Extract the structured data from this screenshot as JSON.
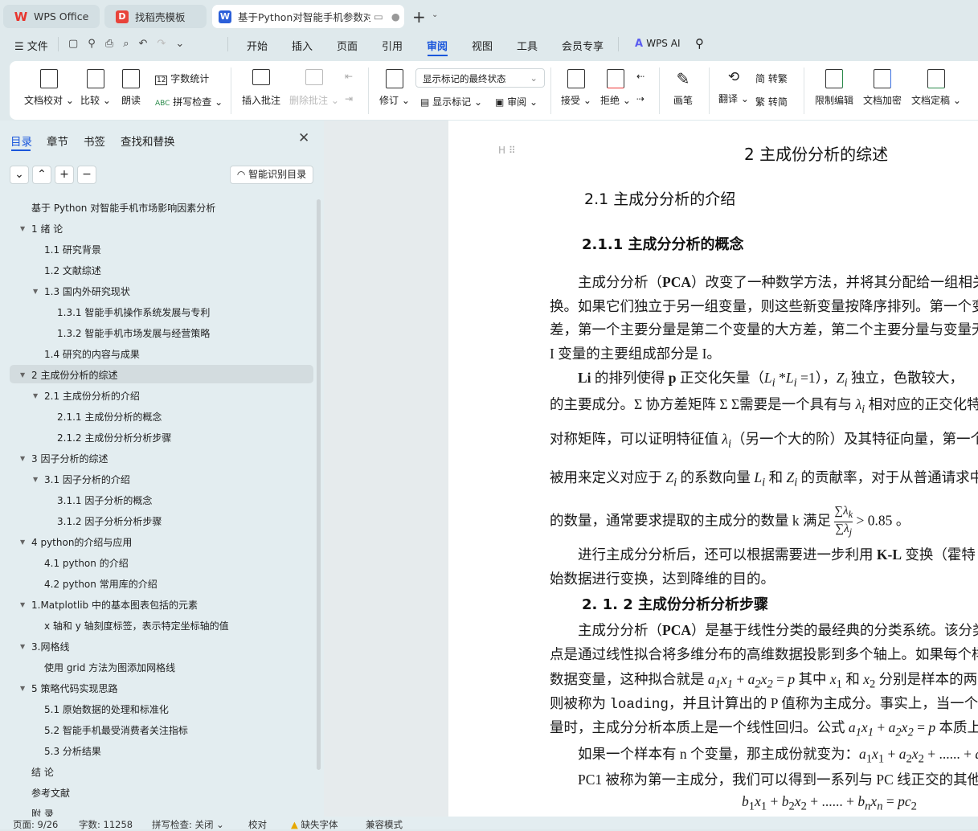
{
  "tabs": [
    {
      "label": "WPS Office",
      "icon": "wps-logo"
    },
    {
      "label": "找稻壳模板",
      "icon": "docer-logo"
    },
    {
      "label": "基于Python对智能手机参数对",
      "icon": "word-doc-icon"
    }
  ],
  "menu": {
    "file": "文件",
    "items": [
      "开始",
      "插入",
      "页面",
      "引用",
      "审阅",
      "视图",
      "工具",
      "会员专享"
    ],
    "active": "审阅",
    "wps_ai": "WPS AI"
  },
  "ribbon": {
    "proofread": "文档校对",
    "compare": "比较",
    "read_aloud": "朗读",
    "word_count": "字数统计",
    "spell_check": "拼写检查",
    "insert_comment": "插入批注",
    "delete_comment": "删除批注",
    "track": "修订",
    "markup_dropdown": "显示标记的最终状态",
    "show_markup": "显示标记",
    "review": "审阅",
    "accept": "接受",
    "reject": "拒绝",
    "pen": "画笔",
    "translate": "翻译",
    "to_traditional": "转繁",
    "to_simplified": "转简",
    "restrict": "限制编辑",
    "encrypt": "文档加密",
    "finalize": "文档定稿"
  },
  "sidebar": {
    "tabs": [
      "目录",
      "章节",
      "书签",
      "查找和替换"
    ],
    "active_tab": "目录",
    "smart_toc": "智能识别目录",
    "items": [
      {
        "label": "基于 Python 对智能手机市场影响因素分析",
        "level": 0,
        "toggle": false
      },
      {
        "label": "1  绪  论",
        "level": 0,
        "toggle": true
      },
      {
        "label": "1.1 研究背景",
        "level": 1,
        "toggle": false
      },
      {
        "label": "1.2 文献综述",
        "level": 1,
        "toggle": false
      },
      {
        "label": "1.3 国内外研究现状",
        "level": 1,
        "toggle": true
      },
      {
        "label": "1.3.1 智能手机操作系统发展与专利",
        "level": 2,
        "toggle": false
      },
      {
        "label": "1.3.2 智能手机市场发展与经营策略",
        "level": 2,
        "toggle": false
      },
      {
        "label": "1.4  研究的内容与成果",
        "level": 1,
        "toggle": false
      },
      {
        "label": "2 主成份分析的综述",
        "level": 0,
        "toggle": true,
        "selected": true
      },
      {
        "label": "2.1 主成份分析的介绍",
        "level": 1,
        "toggle": true
      },
      {
        "label": "2.1.1 主成份分析的概念",
        "level": 2,
        "toggle": false
      },
      {
        "label": "2.1.2 主成份分析分析步骤",
        "level": 2,
        "toggle": false
      },
      {
        "label": "3  因子分析的综述",
        "level": 0,
        "toggle": true
      },
      {
        "label": "3.1  因子分析的介绍",
        "level": 1,
        "toggle": true
      },
      {
        "label": "3.1.1  因子分析的概念",
        "level": 2,
        "toggle": false
      },
      {
        "label": "3.1.2 因子分析分析步骤",
        "level": 2,
        "toggle": false
      },
      {
        "label": "4 python的介绍与应用",
        "level": 0,
        "toggle": true
      },
      {
        "label": "4.1 python 的介绍",
        "level": 1,
        "toggle": false
      },
      {
        "label": "4.2 python 常用库的介绍",
        "level": 1,
        "toggle": false
      },
      {
        "label": "1.Matplotlib 中的基本图表包括的元素",
        "level": 0,
        "toggle": true
      },
      {
        "label": "x 轴和 y 轴刻度标签，表示特定坐标轴的值",
        "level": 1,
        "toggle": false
      },
      {
        "label": "3.网格线",
        "level": 0,
        "toggle": true
      },
      {
        "label": "使用 grid 方法为图添加网格线",
        "level": 1,
        "toggle": false
      },
      {
        "label": "5 策略代码实现思路",
        "level": 0,
        "toggle": true
      },
      {
        "label": "5.1  原始数据的处理和标准化",
        "level": 1,
        "toggle": false
      },
      {
        "label": "5.2  智能手机最受消费者关注指标",
        "level": 1,
        "toggle": false
      },
      {
        "label": "5.3  分析结果",
        "level": 1,
        "toggle": false
      },
      {
        "label": "结  论",
        "level": 0,
        "toggle": false
      },
      {
        "label": "参考文献",
        "level": 0,
        "toggle": false
      },
      {
        "label": "附  录",
        "level": 0,
        "toggle": false
      }
    ]
  },
  "doc": {
    "h1": "2 主成份分析的综述",
    "h2": "2.1 主成分分析的介绍",
    "h3": "2.1.1 主成分分析的概念",
    "h3b": "2. 1. 2 主成份分析分析步骤",
    "lines": [
      "　　主成分分析（<b>PCA</b>）改变了一种数学方法，并将其分配给一组相关",
      "换。如果它们独立于另一组变量，则这些新变量按降序排列。第一个变",
      "差，第一个主要分量是第二个变量的大方差，第二个主要分量与变量无",
      "I 变量的主要组成部分是 I。",
      "　　<b>Li</b> 的排列使得 <b>p</b> 正交化矢量（<i>L<sub>i</sub></i> *<i>L<sub>i</sub></i> =1），<i>Z<sub>i</sub></i> 独立，色散较大，",
      "的主要成分。Σ 协方差矩阵 Σ Σ需要是一个具有与 <i>λ<sub>i</sub></i> 相对应的正交化特",
      "对称矩阵，可以证明特征值 <i>λ<sub>i</sub></i>（另一个大的阶）及其特征向量，第一个主",
      "被用来定义对应于 <i>Z<sub>i</sub></i> 的系数向量 <i>L<sub>i</sub></i> 和 <i>Z<sub>i</sub></i> 的贡献率，对于从普通请求中",
      "的数量，通常要求提取的主成分的数量 k 满足 <span class=\"frac\"><span>∑<i>λ<sub>k</sub></i></span><span>∑<i>λ<sub>j</sub></i></span></span> &gt; 0.85 。",
      "　　进行主成分分析后，还可以根据需要进一步利用 <b>K-L</b> 变换（霍特",
      "始数据进行变换，达到降维的目的。",
      "　　主成分分析（<b>PCA</b>）是基于线性分类的最经典的分类系统。该分类",
      "点是通过线性拟合将多维分布的高维数据投影到多个轴上。如果每个样",
      "数据变量，这种拟合就是 <i>a<sub>1</sub>x<sub>1</sub></i> + <i>a<sub>2</sub>x<sub>2</sub></i> = <i>p</i> 其中 <i>x</i><sub>1</sub> 和 <i>x</i><sub>2</sub> 分别是样本的两个变",
      "则被称为 <span style=\"font-family:'Liberation Mono',monospace\">loading</span>，并且计算出的 P 值称为主成分。事实上，当一个样",
      "量时，主成分分析本质上是一个线性回归。公式 <i>a<sub>1</sub>x<sub>1</sub></i> + <i>a<sub>2</sub>x<sub>2</sub></i> = <i>p</i> 本质上是",
      "　　如果一个样本有 n 个变量，那主成份就变为：<i>a</i><sub>1</sub><i>x</i><sub>1</sub> + <i>a</i><sub>2</sub><i>x</i><sub>2</sub> + ...... + <i>a<sub>n</sub></i>",
      "　　PC1 被称为第一主成分，我们可以得到一系列与 PC 线正交的其他",
      "<i>b</i><sub>1</sub><i>x</i><sub>1</sub> + <i>b</i><sub>2</sub><i>x</i><sub>2</sub> + ...... + <i>b<sub>n</sub>x<sub>n</sub></i> = <i>pc</i><sub>2</sub>"
    ]
  },
  "status": {
    "page": "页面: 9/26",
    "words": "字数: 11258",
    "spell": "拼写检查: 关闭",
    "proof": "校对",
    "missing_font": "缺失字体",
    "compat": "兼容模式"
  },
  "colors": {
    "accent": "#1a56db",
    "selected_row": "#d3dcdf",
    "wps_red": "#e8352e"
  }
}
